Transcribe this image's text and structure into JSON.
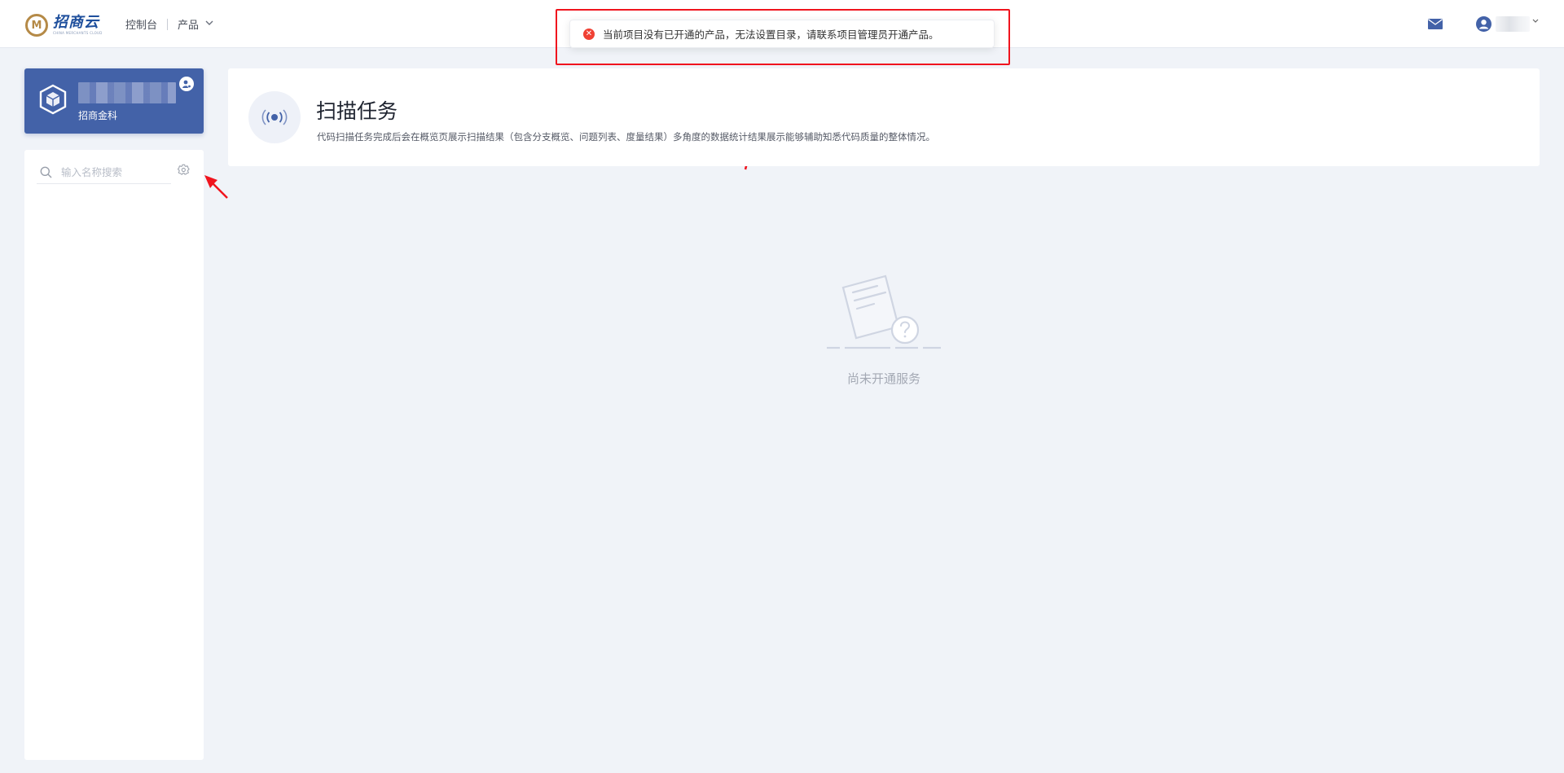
{
  "header": {
    "logo_text": "招商云",
    "logo_sub": "CHINA MERCHANTS CLOUD",
    "nav": [
      {
        "label": "控制台"
      },
      {
        "label": "产品"
      }
    ],
    "icons": [
      "mail-icon",
      "user-icon",
      "chevron-down-icon"
    ]
  },
  "toast": {
    "type": "error",
    "message": "当前项目没有已开通的产品，无法设置目录，请联系项目管理员开通产品。"
  },
  "sidebar": {
    "project": {
      "subtitle": "招商金科"
    },
    "search": {
      "placeholder": "输入名称搜索",
      "value": ""
    }
  },
  "main": {
    "title": "扫描任务",
    "description": "代码扫描任务完成后会在概览页展示扫描结果（包含分支概览、问题列表、度量结果）多角度的数据统计结果展示能够辅助知悉代码质量的整体情况。",
    "empty_text": "尚未开通服务"
  },
  "colors": {
    "accent": "#4362a8",
    "error": "#f04134",
    "annotation": "#f0141e",
    "background": "#f0f3f8"
  }
}
